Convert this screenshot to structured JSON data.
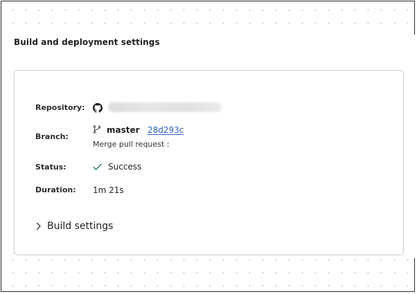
{
  "section": {
    "title": "Build and deployment settings"
  },
  "details": {
    "repository_label": "Repository:",
    "branch_label": "Branch:",
    "status_label": "Status:",
    "duration_label": "Duration:",
    "branch_name": "master",
    "commit_hash": "28d293c",
    "commit_message": "Merge pull request :",
    "status_value": "Success",
    "duration_value": "1m 21s"
  },
  "build_settings": {
    "label": "Build settings"
  },
  "icons": {
    "repository": "github-icon",
    "branch": "git-branch-icon",
    "status": "check-icon",
    "expand": "chevron-right-icon"
  },
  "colors": {
    "link": "#2f62c9",
    "success": "#2e7d5b"
  }
}
